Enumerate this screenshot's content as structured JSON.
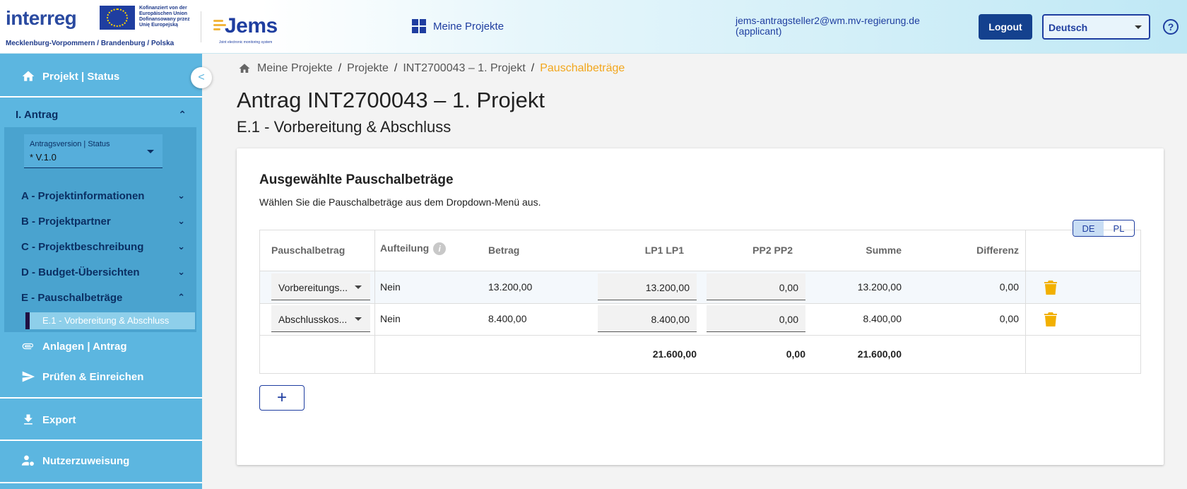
{
  "header": {
    "logo_text": "interreg",
    "region_text": "Mecklenburg-Vorpommern / Brandenburg / Polska",
    "eu_text": "Kofinanziert von der Europäischen Union Dofinansowany przez Unię Europejską",
    "jems_logo": "Jems",
    "jems_tagline": "Joint electronic monitoring system",
    "nav_label": "Meine Projekte",
    "user_email": "jems-antragsteller2@wm.mv-regierung.de",
    "user_role": "(applicant)",
    "logout_label": "Logout",
    "language_value": "Deutsch",
    "help_label": "?"
  },
  "sidebar": {
    "project_status_label": "Projekt | Status",
    "collapse_icon": "<",
    "antrag_label": "I. Antrag",
    "version_label": "Antragsversion | Status",
    "version_value": "* V.1.0",
    "sections": [
      {
        "label": "A - Projektinformationen",
        "chevron": "v"
      },
      {
        "label": "B - Projektpartner",
        "chevron": "v"
      },
      {
        "label": "C - Projektbeschreibung",
        "chevron": "v"
      },
      {
        "label": "D - Budget-Übersichten",
        "chevron": "v"
      },
      {
        "label": "E - Pauschalbeträge",
        "chevron": "^"
      }
    ],
    "active_sub_item": "E.1 - Vorbereitung & Abschluss",
    "attachments_label": "Anlagen | Antrag",
    "check_submit_label": "Prüfen & Einreichen",
    "export_label": "Export",
    "user_assignment_label": "Nutzerzuweisung"
  },
  "breadcrumb": {
    "items": [
      "Meine Projekte",
      "Projekte",
      "INT2700043 – 1. Projekt",
      "Pauschalbeträge"
    ],
    "separator": "/"
  },
  "page": {
    "title": "Antrag INT2700043 – 1. Projekt",
    "subtitle": "E.1 - Vorbereitung & Abschluss"
  },
  "card": {
    "title": "Ausgewählte Pauschalbeträge",
    "description": "Wählen Sie die Pauschalbeträge aus dem Dropdown-Menü aus.",
    "lang_toggle": {
      "de": "DE",
      "pl": "PL",
      "active": "DE"
    },
    "table": {
      "headers": {
        "lump_sum": "Pauschalbetrag",
        "split": "Aufteilung",
        "amount": "Betrag",
        "lp1": "LP1 LP1",
        "pp2": "PP2 PP2",
        "sum": "Summe",
        "difference": "Differenz"
      },
      "info_icon": "i",
      "rows": [
        {
          "lump_sum": "Vorbereitungs...",
          "split": "Nein",
          "amount": "13.200,00",
          "lp1": "13.200,00",
          "pp2": "0,00",
          "sum": "13.200,00",
          "difference": "0,00"
        },
        {
          "lump_sum": "Abschlusskos...",
          "split": "Nein",
          "amount": "8.400,00",
          "lp1": "8.400,00",
          "pp2": "0,00",
          "sum": "8.400,00",
          "difference": "0,00"
        }
      ],
      "totals": {
        "lp1": "21.600,00",
        "pp2": "0,00",
        "sum": "21.600,00"
      }
    },
    "add_label": "+"
  },
  "colors": {
    "sidebar_bg": "#5cb6e0",
    "primary": "#1f3ea0",
    "accent": "#f2a61c",
    "logout_bg": "#14418e",
    "trash": "#f2b000"
  },
  "icons": [
    "grid-icon",
    "help-icon",
    "home-icon",
    "chevron-left-icon",
    "chevron-down-icon",
    "chevron-up-icon",
    "paperclip-icon",
    "send-icon",
    "download-icon",
    "user-gear-icon",
    "info-icon",
    "trash-icon",
    "plus-icon",
    "caret-down-icon"
  ]
}
